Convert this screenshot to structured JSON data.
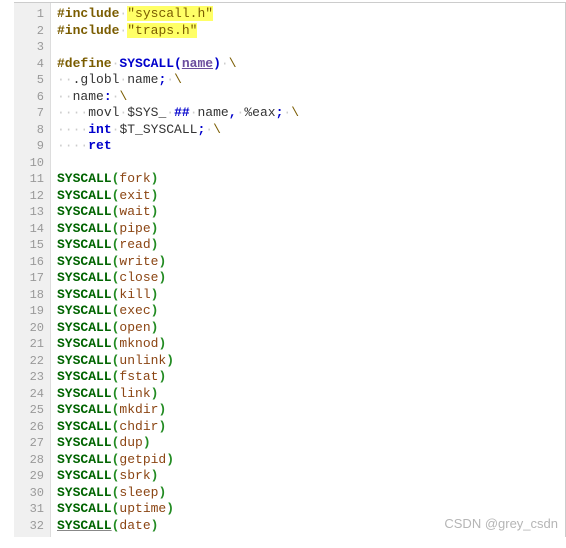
{
  "syscalls": [
    "fork",
    "exit",
    "wait",
    "pipe",
    "read",
    "write",
    "close",
    "kill",
    "exec",
    "open",
    "mknod",
    "unlink",
    "fstat",
    "link",
    "mkdir",
    "chdir",
    "dup",
    "getpid",
    "sbrk",
    "sleep",
    "uptime",
    "date"
  ],
  "lines": {
    "l1": {
      "inc": "#include",
      "sp": "·",
      "str": "\"syscall.h\""
    },
    "l2": {
      "inc": "#include",
      "sp": "·",
      "str": "\"traps.h\""
    },
    "l4": {
      "def": "#define",
      "sp": "·",
      "mac": "SYSCALL",
      "po": "(",
      "arg": "name",
      "pc": ")",
      "slash": "\\"
    },
    "l5": {
      "dots": "··",
      "glob": ".globl",
      "sp": "·",
      "nm": "name",
      "semi": ";",
      "sp2": "·",
      "slash": "\\"
    },
    "l6": {
      "dots": "··",
      "nm": "name",
      "colon": ":",
      "sp": "·",
      "slash": "\\"
    },
    "l7": {
      "dots": "····",
      "mov": "movl",
      "sp": "·",
      "sys": "$SYS_",
      "sp2": "·",
      "hh": "##",
      "sp3": "·",
      "nm": "name",
      "comma": ",",
      "sp4": "·",
      "eax": "%eax",
      "semi": ";",
      "sp5": "·",
      "slash": "\\"
    },
    "l8": {
      "dots": "····",
      "int": "int",
      "sp": "·",
      "tsys": "$T_SYSCALL",
      "semi": ";",
      "sp2": "·",
      "slash": "\\"
    },
    "l9": {
      "dots": "····",
      "ret": "ret"
    }
  },
  "watermark": "CSDN @grey_csdn",
  "macro": "SYSCALL",
  "po": "(",
  "pc": ")"
}
